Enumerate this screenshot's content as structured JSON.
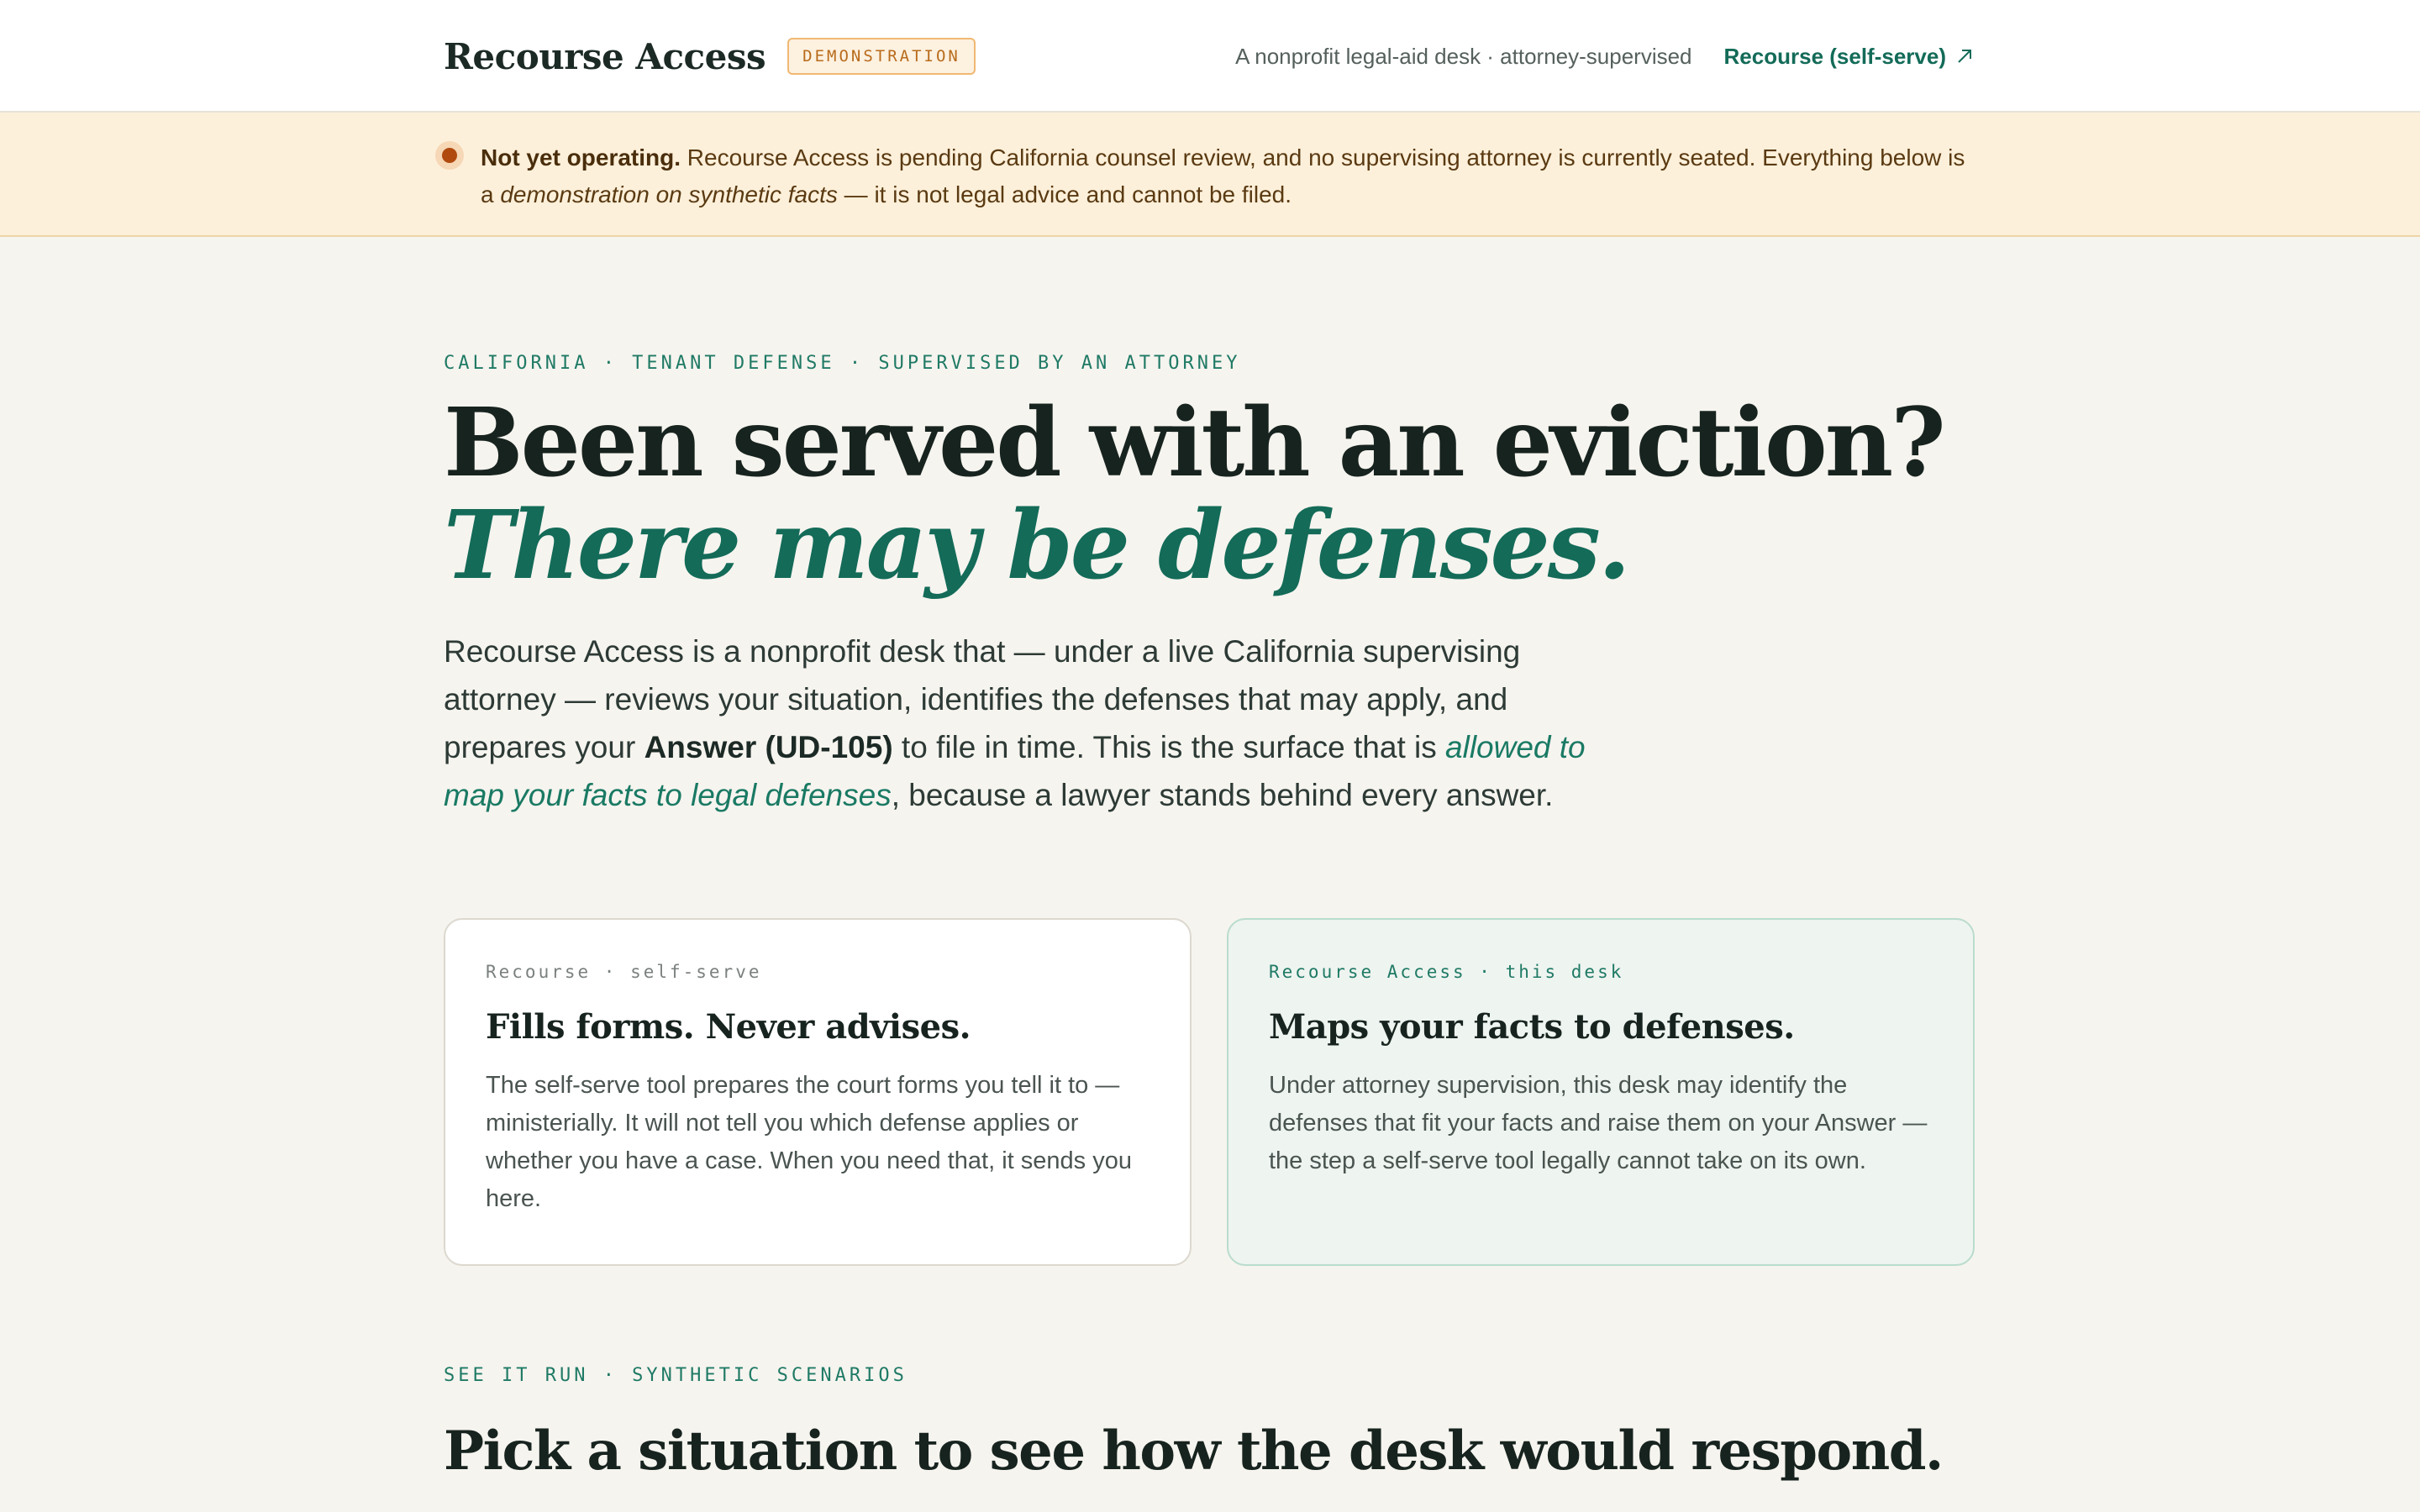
{
  "header": {
    "brand": "Recourse Access",
    "badge": "DEMONSTRATION",
    "tagline": "A nonprofit legal-aid desk · attorney-supervised",
    "link_label": "Recourse (self-serve)"
  },
  "banner": {
    "lead": "Not yet operating.",
    "text_1": " Recourse Access is pending California counsel review, and no supervising attorney is currently seated. Everything below is a ",
    "em": "demonstration on synthetic facts",
    "text_2": " — it is not legal advice and cannot be filed."
  },
  "hero": {
    "eyebrow": "CALIFORNIA · TENANT DEFENSE · SUPERVISED BY AN ATTORNEY",
    "title_plain": "Been served with an eviction? ",
    "title_accent": "There may be defenses.",
    "lede_1": "Recourse Access is a nonprofit desk that — under a live California supervising attorney — reviews your situation, identifies the defenses that may apply, and prepares your ",
    "lede_bold": "Answer (UD-105)",
    "lede_2": " to file in time. This is the surface that is ",
    "lede_em": "allowed to map your facts to legal defenses",
    "lede_3": ", because a lawyer stands behind every answer."
  },
  "cards": [
    {
      "kicker": "Recourse · self-serve",
      "title": "Fills forms. Never advises.",
      "body": "The self-serve tool prepares the court forms you tell it to — ministerially. It will not tell you which defense applies or whether you have a case. When you need that, it sends you here."
    },
    {
      "kicker": "Recourse Access · this desk",
      "title": "Maps your facts to defenses.",
      "body": "Under attorney supervision, this desk may identify the defenses that fit your facts and raise them on your Answer — the step a self-serve tool legally cannot take on its own."
    }
  ],
  "section": {
    "eyebrow": "SEE IT RUN · SYNTHETIC SCENARIOS",
    "title": "Pick a situation to see how the desk would respond."
  },
  "colors": {
    "accent": "#136b58",
    "banner_bg": "#fdf0da",
    "page_bg": "#f6f4ef"
  }
}
